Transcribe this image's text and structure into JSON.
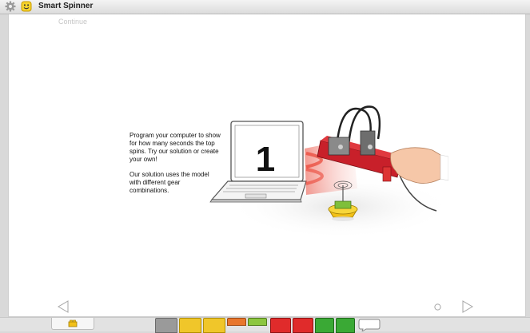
{
  "window": {
    "title": "Smart Spinner",
    "settings_icon": "gear-icon",
    "user_icon": "smiley-face-icon"
  },
  "content": {
    "continue_label": "Continue",
    "step_number": "1",
    "paragraph_1": "Program your computer to show for how many seconds the top spins. Try our solution or create your own!",
    "paragraph_2": "Our solution uses the model with different gear combinations."
  },
  "navigation": {
    "prev_icon": "left-triangle-arrow-icon",
    "page_indicator_icon": "page-dot-icon",
    "next_icon": "right-triangle-arrow-icon"
  },
  "bottom_bar": {
    "tab_icon": "lego-brick-icon",
    "palette_blocks": [
      {
        "icon": "motor-block-icon",
        "color": "#9a9a9a"
      },
      {
        "icon": "wait-block-icon",
        "color": "#f0c62a"
      },
      {
        "icon": "loop-block-icon",
        "color": "#f0c62a"
      },
      {
        "icon": "sound-block-icon",
        "color": "#e8762c"
      },
      {
        "icon": "sensor-block-icon",
        "color": "#8cc63f"
      },
      {
        "icon": "display-block-icon",
        "color": "#e02b2b"
      },
      {
        "icon": "send-block-icon",
        "color": "#e02b2b"
      },
      {
        "icon": "math-add-block-icon",
        "color": "#3aa935"
      },
      {
        "icon": "math-multiply-block-icon",
        "color": "#3aa935"
      },
      {
        "icon": "comment-icon",
        "color": "#ffffff"
      }
    ]
  }
}
